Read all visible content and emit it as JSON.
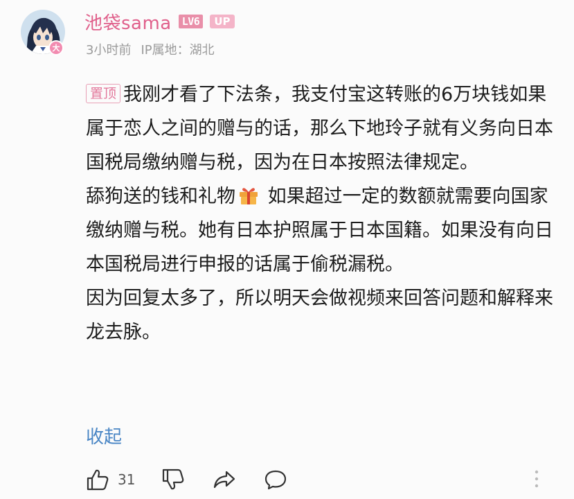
{
  "comment": {
    "username": "池袋sama",
    "level_badge": "LV6",
    "up_badge": "UP",
    "avatar_badge": "大",
    "time": "3小时前",
    "location": "IP属地：湖北",
    "pin_label": "置顶",
    "paragraph_1": "我刚才看了下法条，我支付宝这转账的6万块钱如果属于恋人之间的赠与的话，那么下地玲子就有义务向日本国税局缴纳赠与税，因为在日本按照法律规定。",
    "paragraph_2_a": "舔狗送的钱和礼物",
    "gift_icon": "gift-icon",
    "paragraph_2_b": " 如果超过一定的数额就需要向国家缴纳赠与税。她有日本护照属于日本国籍。如果没有向日本国税局进行申报的话属于偷税漏税。",
    "paragraph_3": "因为回复太多了，所以明天会做视频来回答问题和解释来龙去脉。",
    "collapse_label": "收起",
    "like_count": "31"
  },
  "colors": {
    "username": "#e0608b",
    "link": "#4a86c5",
    "meta": "#9a9a9a"
  }
}
